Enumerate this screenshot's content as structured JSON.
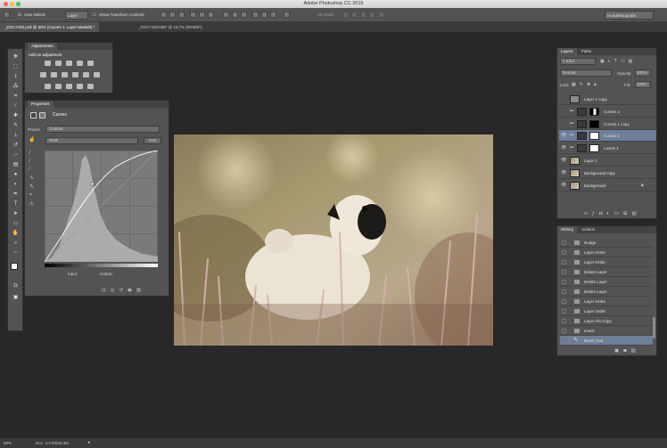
{
  "app": {
    "title": "Adobe Photoshop CC 2015"
  },
  "options_bar": {
    "auto_select_label": "Auto-Select:",
    "auto_select_value": "Layer",
    "show_transform_label": "Show Transform Controls",
    "mode_3d_label": "3D Mode:",
    "workspace_value": "Hundefotografie"
  },
  "doc_tabs": [
    {
      "label": "_DSC7430.psd @ 50% (Curves 1, Layer Mask/8) *"
    },
    {
      "label": "_DSC7430.NEF @ 16,7% (RGB/8*)"
    }
  ],
  "adjustments": {
    "tab": "Adjustments",
    "heading": "Add an adjustment"
  },
  "properties": {
    "tab": "Properties",
    "type_label": "Curves",
    "preset_label": "Preset:",
    "preset_value": "Custom",
    "channel_value": "RGB",
    "auto_label": "Auto",
    "input_label": "Input:",
    "output_label": "Output:"
  },
  "layers_panel": {
    "tabs": [
      "Layers",
      "Paths"
    ],
    "kind_value": "Kind",
    "blend_mode": "Normal",
    "opacity_label": "Opacity:",
    "opacity_value": "100%",
    "lock_label": "Lock:",
    "fill_label": "Fill:",
    "fill_value": "100%",
    "layers": [
      {
        "name": "Layer 1 copy",
        "visible": false,
        "thumb": "gray",
        "mask": false,
        "selected": false,
        "lock": false
      },
      {
        "name": "Curves 2",
        "visible": false,
        "thumb": "adj",
        "mask": "white-black",
        "selected": false,
        "lock": false
      },
      {
        "name": "Curves 1 copy",
        "visible": false,
        "thumb": "adj",
        "mask": "black",
        "selected": false,
        "lock": false
      },
      {
        "name": "Curves 1",
        "visible": true,
        "thumb": "adj",
        "mask": "white",
        "selected": true,
        "lock": false
      },
      {
        "name": "Levels 1",
        "visible": true,
        "thumb": "adj",
        "mask": "white",
        "selected": false,
        "lock": false
      },
      {
        "name": "Layer 1",
        "visible": true,
        "thumb": "photo",
        "mask": false,
        "selected": false,
        "lock": false
      },
      {
        "name": "Background copy",
        "visible": true,
        "thumb": "photo",
        "mask": false,
        "selected": false,
        "lock": false
      },
      {
        "name": "Background",
        "visible": true,
        "thumb": "photo",
        "mask": false,
        "selected": false,
        "lock": true
      }
    ]
  },
  "history_panel": {
    "tabs": [
      "History",
      "Actions"
    ],
    "items": [
      {
        "label": "Nudge",
        "selected": false
      },
      {
        "label": "Layer Order",
        "selected": false
      },
      {
        "label": "Layer Order",
        "selected": false
      },
      {
        "label": "Delete Layer",
        "selected": false
      },
      {
        "label": "Delete Layer",
        "selected": false
      },
      {
        "label": "Delete Layer",
        "selected": false
      },
      {
        "label": "Layer Order",
        "selected": false
      },
      {
        "label": "Layer Order",
        "selected": false
      },
      {
        "label": "Layer Via Copy",
        "selected": false
      },
      {
        "label": "Invert",
        "selected": false
      },
      {
        "label": "Brush Tool",
        "selected": true
      }
    ]
  },
  "status_bar": {
    "zoom": "50%",
    "doc_size": "Doc: 4,17M/34,4M"
  },
  "colors": {
    "selection": "#6d7f99",
    "panel": "#535353",
    "background": "#282828"
  }
}
